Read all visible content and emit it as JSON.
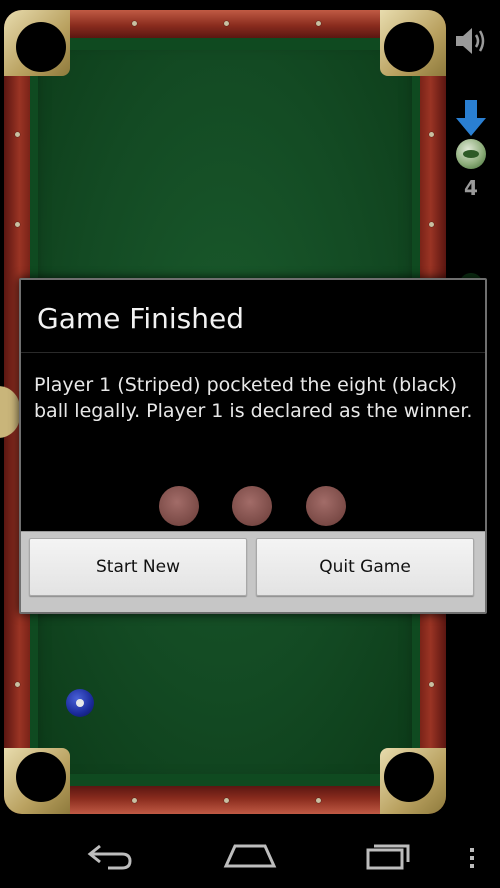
{
  "dialog": {
    "title": "Game Finished",
    "message": "Player 1 (Striped) pocketed the eight (black) ball legally. Player 1 is declared as the winner.",
    "start_label": "Start New",
    "quit_label": "Quit Game"
  },
  "side_panel": {
    "current_count": "4",
    "other_count": "3",
    "icons": [
      "speaker-icon",
      "down-arrow-icon",
      "ball-icon"
    ]
  },
  "navbar": {
    "icons": [
      "back-icon",
      "home-icon",
      "recent-apps-icon",
      "menu-icon"
    ]
  },
  "colors": {
    "felt": "#134a23",
    "rail": "#8a2a1e",
    "dialog_bg": "#000000",
    "button_bg": "#e8e8e8",
    "arrow": "#2a7fd2"
  }
}
